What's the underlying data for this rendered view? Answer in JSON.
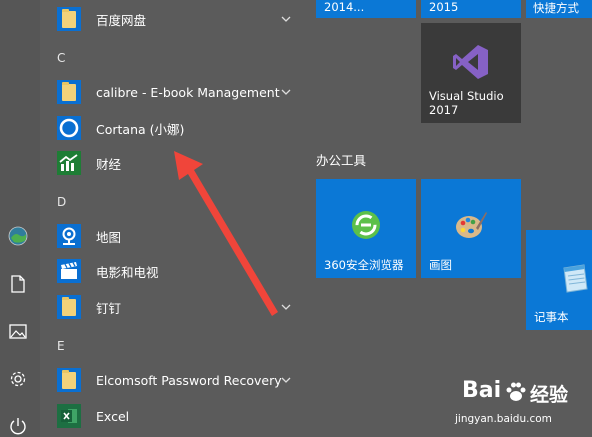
{
  "sidebar": {
    "icons": [
      "avatar-icon",
      "document-icon",
      "pictures-icon",
      "settings-icon",
      "power-icon"
    ]
  },
  "app_list": {
    "items": [
      {
        "kind": "app",
        "label": "百度网盘",
        "icon": "folder-icon",
        "expandable": true
      },
      {
        "kind": "letter",
        "label": "C"
      },
      {
        "kind": "app",
        "label": "calibre - E-book Management",
        "icon": "folder-icon",
        "expandable": true
      },
      {
        "kind": "app",
        "label": "Cortana (小娜)",
        "icon": "cortana-icon",
        "expandable": false
      },
      {
        "kind": "app",
        "label": "财经",
        "icon": "finance-icon",
        "expandable": false
      },
      {
        "kind": "letter",
        "label": "D"
      },
      {
        "kind": "app",
        "label": "地图",
        "icon": "maps-icon",
        "expandable": false
      },
      {
        "kind": "app",
        "label": "电影和电视",
        "icon": "movies-icon",
        "expandable": false
      },
      {
        "kind": "app",
        "label": "钉钉",
        "icon": "folder-icon",
        "expandable": true
      },
      {
        "kind": "letter",
        "label": "E"
      },
      {
        "kind": "app",
        "label": "Elcomsoft Password Recovery",
        "icon": "folder-icon",
        "expandable": true
      },
      {
        "kind": "app",
        "label": "Excel",
        "icon": "excel-icon",
        "expandable": false
      }
    ]
  },
  "tiles": {
    "top_row": [
      {
        "label": "2014..."
      },
      {
        "label": "2015"
      },
      {
        "label": "快捷方式"
      }
    ],
    "visual_studio": {
      "label_line1": "Visual Studio",
      "label_line2": "2017"
    },
    "group_title": "办公工具",
    "office": [
      {
        "label": "360安全浏览器",
        "icon": "browser-360-icon"
      },
      {
        "label": "画图",
        "icon": "paint-icon"
      },
      {
        "label": "记事本",
        "icon": "notepad-icon"
      }
    ]
  },
  "watermark": {
    "brand": "Bai",
    "brand2": "经验",
    "url": "jingyan.baidu.com"
  },
  "colors": {
    "tile_blue": "#0b78d6",
    "vs_tile": "#3a3a3a",
    "arrow_red": "#f0453a",
    "background": "#5b5b5b"
  }
}
